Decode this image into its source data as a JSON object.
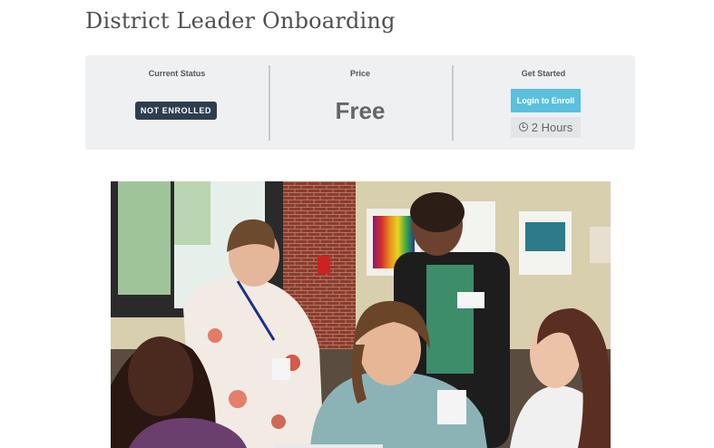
{
  "page": {
    "title": "District Leader Onboarding"
  },
  "status": {
    "current_status_label": "Current Status",
    "badge": "NOT ENROLLED",
    "price_label": "Price",
    "price": "Free",
    "get_started_label": "Get Started",
    "login_button": "Login to Enroll",
    "duration": "2 Hours",
    "duration_icon": "clock-icon",
    "badge_color": "#2d3e50",
    "button_color": "#5bc0de"
  },
  "photo": {
    "icon": "course-photo"
  }
}
